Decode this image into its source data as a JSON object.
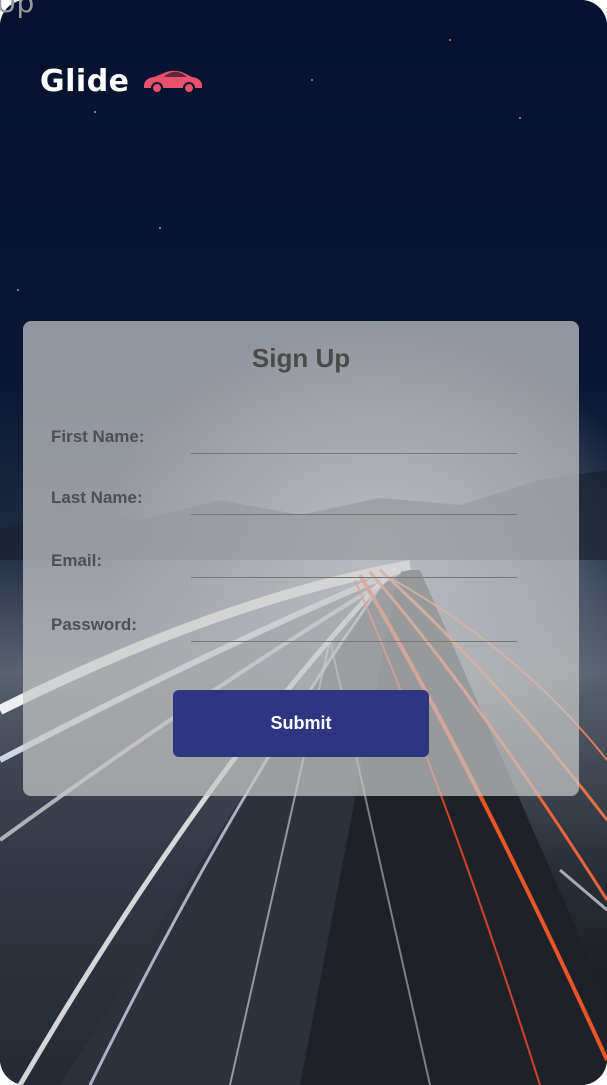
{
  "page": {
    "corner_text": "Up"
  },
  "brand": {
    "name": "Glide",
    "icon": "car-icon",
    "icon_color": "#e9526f"
  },
  "form": {
    "title": "Sign Up",
    "fields": [
      {
        "label": "First Name:",
        "value": ""
      },
      {
        "label": "Last Name:",
        "value": ""
      },
      {
        "label": "Email:",
        "value": ""
      },
      {
        "label": "Password:",
        "value": ""
      }
    ],
    "submit_label": "Submit"
  },
  "colors": {
    "button": "#2e3681",
    "card": "#c8c8c8",
    "sky": "#050d1f"
  }
}
